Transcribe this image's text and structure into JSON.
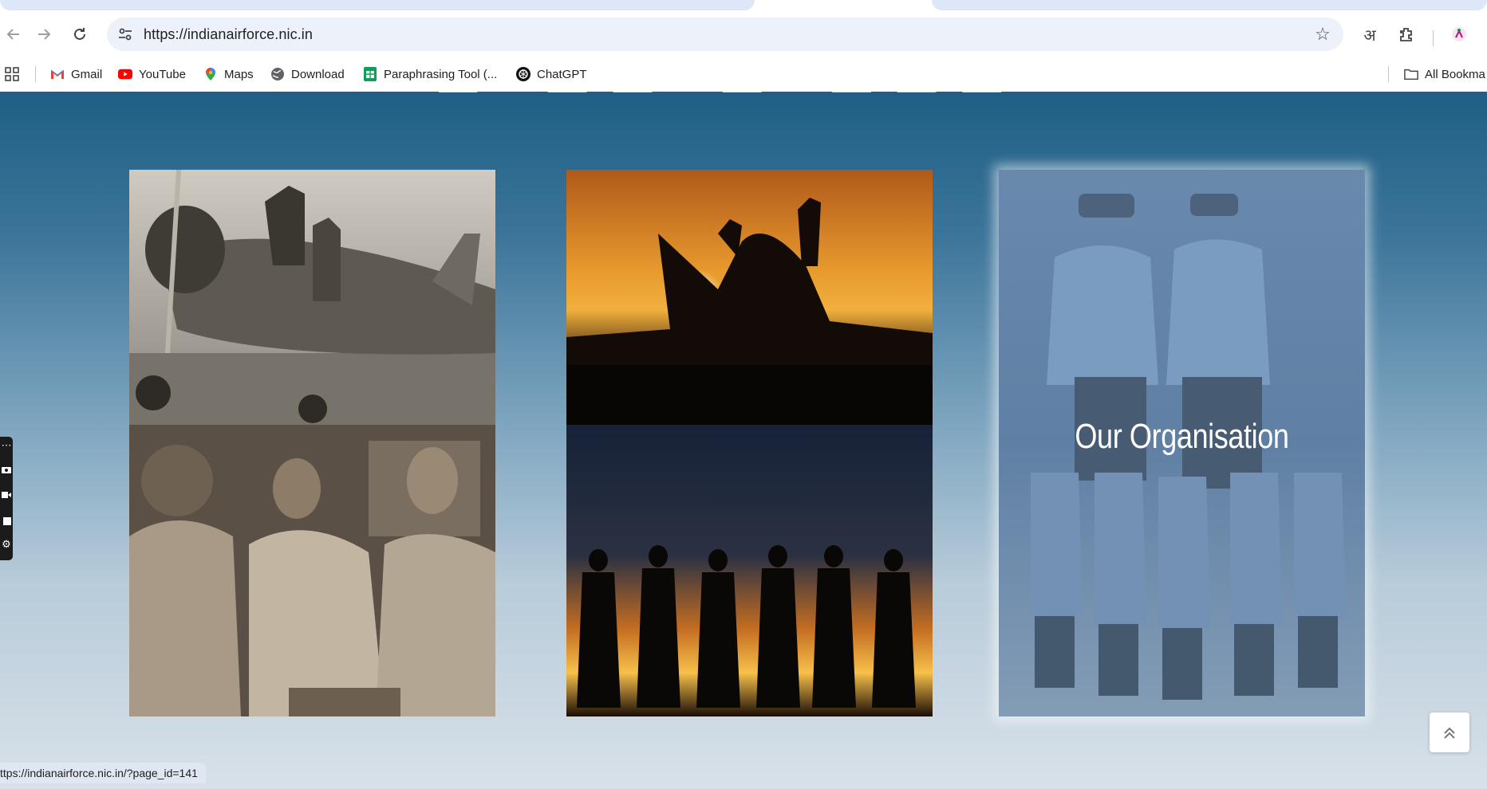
{
  "browser": {
    "url": "https://indianairforce.nic.in",
    "bookmarks": [
      {
        "label": "Gmail",
        "icon": "gmail-icon"
      },
      {
        "label": "YouTube",
        "icon": "youtube-icon"
      },
      {
        "label": "Maps",
        "icon": "maps-icon"
      },
      {
        "label": "Download",
        "icon": "globe-icon"
      },
      {
        "label": "Paraphrasing Tool (...",
        "icon": "sheets-icon"
      },
      {
        "label": "ChatGPT",
        "icon": "chatgpt-icon"
      }
    ],
    "all_bookmarks_label": "All Bookma",
    "translate_glyph": "अ",
    "status_url": "ttps://indianairforce.nic.in/?page_id=141"
  },
  "page": {
    "cards": [
      {
        "name": "history-card"
      },
      {
        "name": "operations-card"
      },
      {
        "name": "organisation-card",
        "label": "Our Organisation"
      }
    ]
  },
  "colors": {
    "page_gradient_top": "#1f5f85",
    "page_gradient_bottom": "#d8e1e9",
    "omnibox_bg": "#edf2fa"
  }
}
